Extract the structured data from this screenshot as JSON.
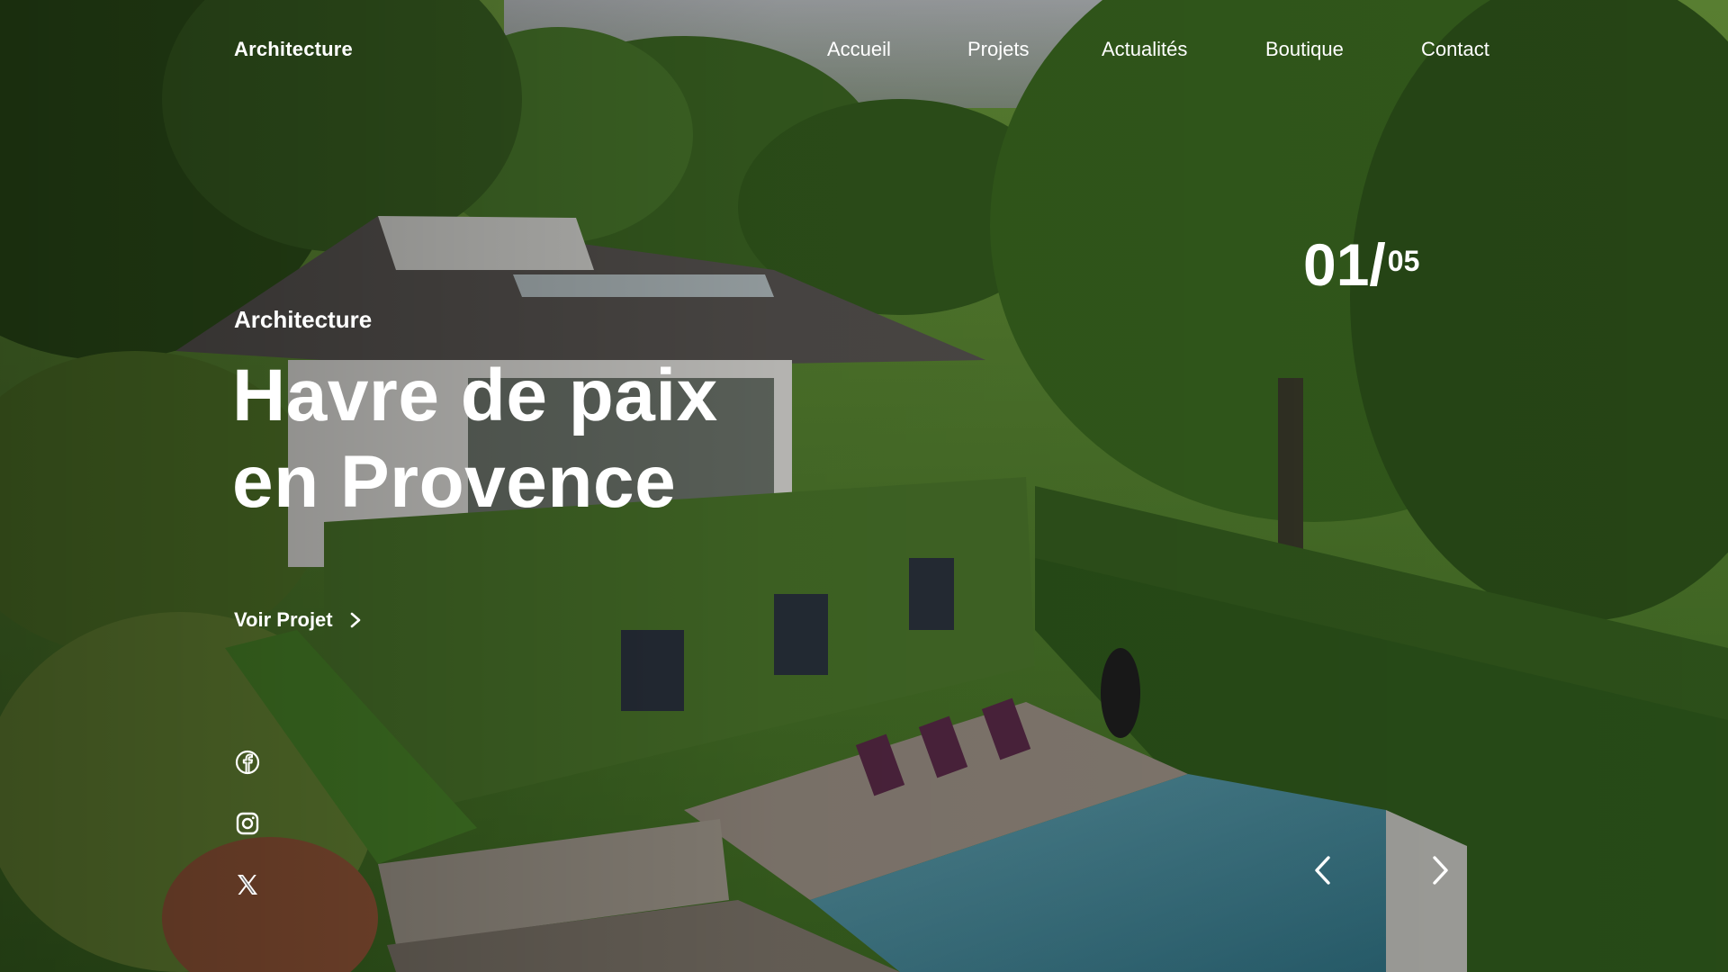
{
  "nav": {
    "brand": "Architecture",
    "links": [
      "Accueil",
      "Projets",
      "Actualités",
      "Boutique",
      "Contact"
    ]
  },
  "hero": {
    "eyebrow": "Architecture",
    "title_line1": "Havre de paix",
    "title_line2": "en Provence",
    "cta_label": "Voir Projet",
    "counter": {
      "current": "01",
      "slash": "/",
      "total": "05"
    }
  },
  "icons": {
    "cta": "chevron-right-icon",
    "social": [
      "facebook-icon",
      "instagram-icon",
      "x-twitter-icon"
    ],
    "prev": "chevron-left-icon",
    "next": "chevron-right-icon"
  },
  "colors": {
    "text": "#ffffff",
    "overlay": "#000000"
  }
}
